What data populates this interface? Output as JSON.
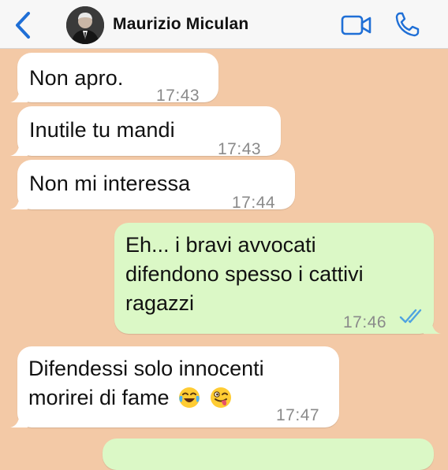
{
  "header": {
    "contact_name": "Maurizio Miculan",
    "back_icon": "chevron-left-icon",
    "video_icon": "video-camera-icon",
    "call_icon": "phone-icon",
    "accent_color": "#1f6fd6"
  },
  "messages": [
    {
      "direction": "in",
      "text": "Non apro.",
      "time": "17:43"
    },
    {
      "direction": "in",
      "text": "Inutile tu mandi",
      "time": "17:43"
    },
    {
      "direction": "in",
      "text": "Non mi interessa",
      "time": "17:44"
    },
    {
      "direction": "out",
      "lines": [
        "Eh... i bravi avvocati",
        "difendono spesso i cattivi",
        "ragazzi"
      ],
      "time": "17:46",
      "status": "read"
    },
    {
      "direction": "in",
      "lines": [
        "Difendessi solo innocenti",
        "morirei di fame"
      ],
      "emojis": [
        "face-with-tears-of-joy",
        "winking-face-with-tongue"
      ],
      "time": "17:47"
    }
  ],
  "colors": {
    "chat_background": "#f3c9a6",
    "incoming_bubble": "#ffffff",
    "outgoing_bubble": "#dbf8c6",
    "read_ticks": "#4fa3e0"
  }
}
